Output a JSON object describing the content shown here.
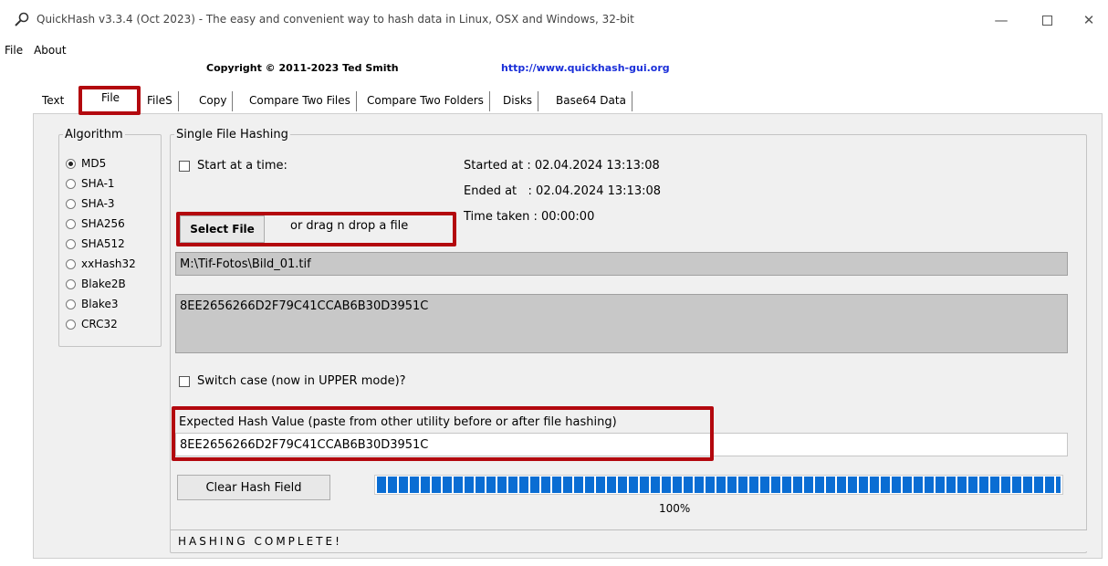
{
  "window": {
    "title": "QuickHash v3.3.4 (Oct 2023) - The easy and convenient way to hash data in Linux, OSX and Windows, 32-bit",
    "minimize": "—",
    "close": "✕"
  },
  "menu": [
    "File",
    "About"
  ],
  "header": {
    "copyright": "Copyright © 2011-2023  Ted Smith",
    "website": "http://www.quickhash-gui.org"
  },
  "tabs": {
    "text": "Text",
    "file": "File",
    "files": "FileS",
    "copy": "Copy",
    "compare_files": "Compare Two Files",
    "compare_folders": "Compare Two Folders",
    "disks": "Disks",
    "base64": "Base64 Data",
    "active": "File"
  },
  "algorithm": {
    "legend": "Algorithm",
    "options": [
      "MD5",
      "SHA-1",
      "SHA-3",
      "SHA256",
      "SHA512",
      "xxHash32",
      "Blake2B",
      "Blake3",
      "CRC32"
    ],
    "selected": "MD5"
  },
  "single": {
    "legend": "Single File Hashing",
    "start_at_time": "Start at a time:",
    "started": "Started at : 02.04.2024 13:13:08",
    "ended": "Ended at   : 02.04.2024 13:13:08",
    "taken": "Time taken : 00:00:00",
    "select_file": "Select File",
    "drop_hint": "or drag n drop a file",
    "file_path": "M:\\Tif-Fotos\\Bild_01.tif",
    "hash_result": "8EE2656266D2F79C41CCAB6B30D3951C",
    "switch_case": "Switch case (now in UPPER mode)?",
    "expected_label": "Expected Hash Value (paste from other utility before or after file hashing)",
    "expected_value": "8EE2656266D2F79C41CCAB6B30D3951C",
    "clear_button": "Clear Hash Field",
    "progress_percent": 100,
    "progress_label": "100%",
    "status": "HASHING COMPLETE!"
  },
  "colors": {
    "highlight_box": "#b3080e",
    "progress": "#0a6dd3",
    "link": "#1a2fd9"
  }
}
